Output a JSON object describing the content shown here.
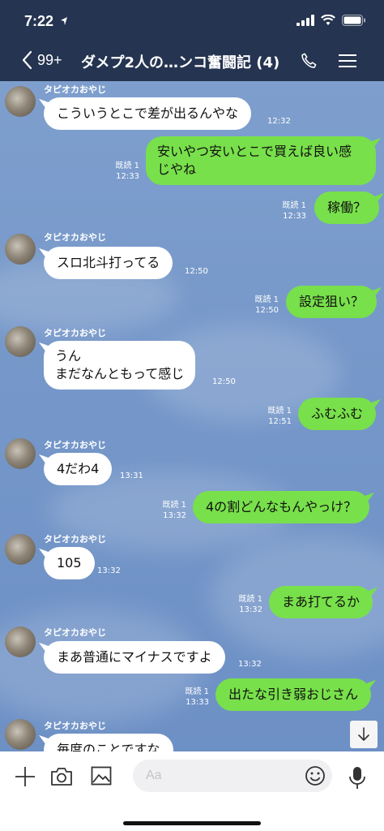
{
  "status_bar": {
    "time": "7:22"
  },
  "header": {
    "back_count": "99+",
    "title": "ダメプ2人の…ンコ奮闘記 (4)"
  },
  "sender_name": "タピオカおやじ",
  "messages": [
    {
      "dir": "in",
      "text": "こういうとこで差が出るんやな",
      "time": "12:32"
    },
    {
      "dir": "out",
      "text": "安いやつ安いとこで買えば良い感\nじやね",
      "read": "既読 1",
      "time": "12:33"
    },
    {
      "dir": "out",
      "text": "稼働？",
      "read": "既読 1",
      "time": "12:33"
    },
    {
      "dir": "in",
      "text": "スロ北斗打ってる",
      "time": "12:50"
    },
    {
      "dir": "out",
      "text": "設定狙い？",
      "read": "既読 1",
      "time": "12:50"
    },
    {
      "dir": "in",
      "text": "うん\nまだなんともって感じ",
      "time": "12:50"
    },
    {
      "dir": "out",
      "text": "ふむふむ",
      "read": "既読 1",
      "time": "12:51"
    },
    {
      "dir": "in",
      "text": "4だわ4",
      "time": "13:31"
    },
    {
      "dir": "out",
      "text": "4の割どんなもんやっけ？",
      "read": "既読 1",
      "time": "13:32"
    },
    {
      "dir": "in",
      "text": "105",
      "time": "13:32"
    },
    {
      "dir": "out",
      "text": "まあ打てるか",
      "read": "既読 1",
      "time": "13:32"
    },
    {
      "dir": "in",
      "text": "まあ普通にマイナスですよ",
      "time": "13:32"
    },
    {
      "dir": "out",
      "text": "出たな引き弱おじさん",
      "read": "既読 1",
      "time": "13:33"
    },
    {
      "dir": "in",
      "text": "毎度のことですな",
      "time": ""
    }
  ],
  "input": {
    "placeholder": "Aa"
  },
  "colors": {
    "header_bg": "#253450",
    "outgoing_bubble": "#78e04b",
    "incoming_bubble": "#ffffff",
    "chat_bg": "#7597c9"
  }
}
